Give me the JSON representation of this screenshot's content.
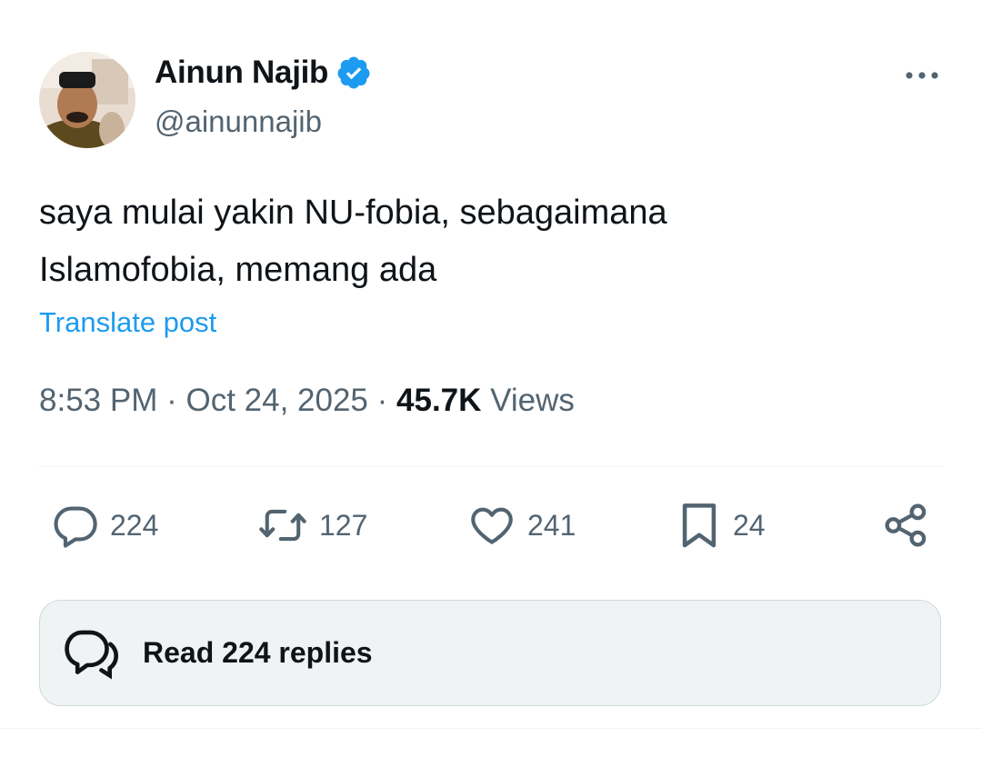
{
  "author": {
    "display_name": "Ainun Najib",
    "handle": "@ainunnajib",
    "verified": true
  },
  "post": {
    "text_line1": "saya mulai yakin NU-fobia, sebagaimana",
    "text_line2": "Islamofobia, memang ada",
    "translate_label": "Translate post",
    "time": "8:53 PM",
    "date": "Oct 24, 2025",
    "separator": "·",
    "views_count": "45.7K",
    "views_label": "Views"
  },
  "actions": {
    "replies": "224",
    "reposts": "127",
    "likes": "241",
    "bookmarks": "24"
  },
  "read_replies_label": "Read 224 replies",
  "colors": {
    "accent": "#1d9bf0",
    "text_primary": "#0f1419",
    "text_secondary": "#536471",
    "divider": "#eff3f4",
    "button_bg": "#eff3f4"
  },
  "icons": {
    "more": "more-horizontal-icon",
    "verified": "verified-badge-icon",
    "reply": "reply-bubble-icon",
    "repost": "repost-icon",
    "like": "heart-icon",
    "bookmark": "bookmark-icon",
    "share": "share-icon",
    "read_replies": "conversation-icon"
  }
}
